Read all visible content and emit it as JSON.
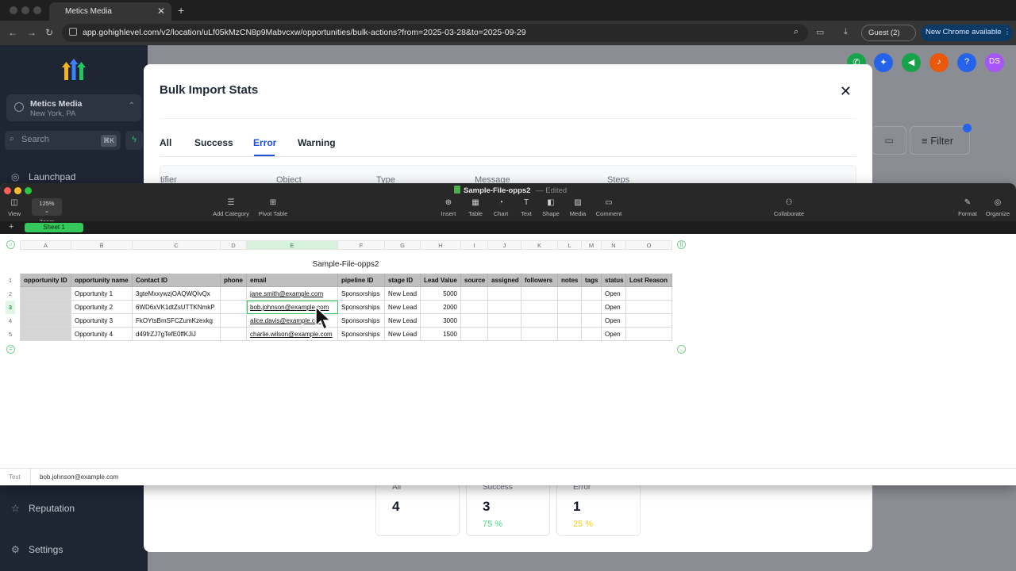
{
  "browser": {
    "tab_title": "Metics Media",
    "url": "app.gohighlevel.com/v2/location/uLf05kMzCN8p9Mabvcxw/opportunities/bulk-actions?from=2025-03-28&to=2025-09-29",
    "guest_label": "Guest (2)",
    "new_chrome_label": "New Chrome available"
  },
  "app": {
    "location_name": "Metics Media",
    "location_sub": "New York, PA",
    "search_placeholder": "Search",
    "search_shortcut": "⌘K",
    "sidebar_items": [
      "Launchpad",
      "Reputation",
      "Settings"
    ],
    "avatar_initials": "DS",
    "filter_label": "Filter",
    "colors": {
      "sidebar": "#1e2533",
      "accent_blue": "#1d4ed8"
    }
  },
  "modal": {
    "title": "Bulk Import Stats",
    "tabs": [
      "All",
      "Success",
      "Error",
      "Warning"
    ],
    "active_tab": "Error",
    "table_headers": [
      "tifier",
      "Object",
      "Type",
      "Message",
      "Steps"
    ],
    "stats": [
      {
        "label": "All",
        "value": "4",
        "pct": ""
      },
      {
        "label": "Success",
        "value": "3",
        "pct": "75 %"
      },
      {
        "label": "Error",
        "value": "1",
        "pct": "25 %"
      }
    ]
  },
  "numbers": {
    "doc_title": "Sample-File-opps2",
    "edited_label": "Edited",
    "zoom": "125%",
    "toolbar": {
      "view": "View",
      "zoom": "Zoom",
      "add_category": "Add Category",
      "pivot_table": "Pivot Table",
      "insert": "Insert",
      "table": "Table",
      "chart": "Chart",
      "text": "Text",
      "shape": "Shape",
      "media": "Media",
      "comment": "Comment",
      "collaborate": "Collaborate",
      "format": "Format",
      "organize": "Organize"
    },
    "sheet_tab": "Sheet 1",
    "table_title": "Sample-File-opps2",
    "columns": [
      "A",
      "B",
      "C",
      "D",
      "E",
      "F",
      "G",
      "H",
      "I",
      "J",
      "K",
      "L",
      "M",
      "N",
      "O"
    ],
    "row_numbers": [
      "1",
      "2",
      "3",
      "4",
      "5"
    ],
    "headers": [
      "opportunity ID",
      "opportunity name",
      "Contact ID",
      "phone",
      "email",
      "pipeline ID",
      "stage ID",
      "Lead Value",
      "source",
      "assigned",
      "followers",
      "notes",
      "tags",
      "status",
      "Lost Reason"
    ],
    "rows": [
      [
        "",
        "Opportunity 1",
        "3gteMxxywzjOAQWQIvQx",
        "",
        "jane.smith@example.com",
        "Sponsorships",
        "New Lead",
        "5000",
        "",
        "",
        "",
        "",
        "",
        "Open",
        ""
      ],
      [
        "",
        "Opportunity 2",
        "6WD6xVK1dtZsUTTKNmkP",
        "",
        "bob.johnson@example.com",
        "Sponsorships",
        "New Lead",
        "2000",
        "",
        "",
        "",
        "",
        "",
        "Open",
        ""
      ],
      [
        "",
        "Opportunity 3",
        "FkOYtsBmSFCZumKzexkg",
        "",
        "alice.davis@example.com",
        "Sponsorships",
        "New Lead",
        "3000",
        "",
        "",
        "",
        "",
        "",
        "Open",
        ""
      ],
      [
        "",
        "Opportunity 4",
        "d49frZJ7gTefE0ffKJiJ",
        "",
        "charlie.wilson@example.com",
        "Sponsorships",
        "New Lead",
        "1500",
        "",
        "",
        "",
        "",
        "",
        "Open",
        ""
      ]
    ],
    "status_bar": {
      "label": "Text",
      "value": "bob.johnson@example.com"
    },
    "selected_cell": "E3"
  }
}
